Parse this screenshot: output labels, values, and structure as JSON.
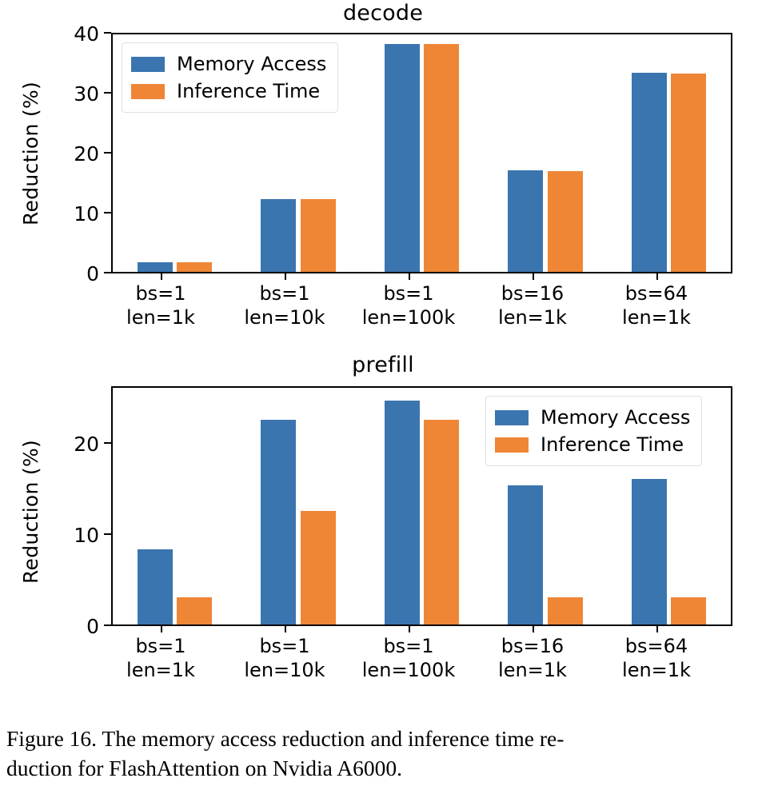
{
  "figure": {
    "caption_line1": "Figure 16.  The memory access reduction and inference time re-",
    "caption_line2": "duction for FlashAttention on Nvidia A6000."
  },
  "colors": {
    "memory_access": "#3b75af",
    "inference_time": "#ef8636",
    "axis": "#000000",
    "background": "#ffffff",
    "legend_border": "#e0e0e0"
  },
  "charts": [
    {
      "id": "decode",
      "title": "decode",
      "ylabel": "Reduction (%)",
      "yticks": [
        "0",
        "10",
        "20",
        "30",
        "40"
      ],
      "categories": [
        {
          "line1": "bs=1",
          "line2": "len=1k"
        },
        {
          "line1": "bs=1",
          "line2": "len=10k"
        },
        {
          "line1": "bs=1",
          "line2": "len=100k"
        },
        {
          "line1": "bs=16",
          "line2": "len=1k"
        },
        {
          "line1": "bs=64",
          "line2": "len=1k"
        }
      ],
      "legend": [
        {
          "label": "Memory Access",
          "color": "#3b75af"
        },
        {
          "label": "Inference Time",
          "color": "#ef8636"
        }
      ]
    },
    {
      "id": "prefill",
      "title": "prefill",
      "ylabel": "Reduction (%)",
      "yticks": [
        "0",
        "10",
        "20"
      ],
      "categories": [
        {
          "line1": "bs=1",
          "line2": "len=1k"
        },
        {
          "line1": "bs=1",
          "line2": "len=10k"
        },
        {
          "line1": "bs=1",
          "line2": "len=100k"
        },
        {
          "line1": "bs=16",
          "line2": "len=1k"
        },
        {
          "line1": "bs=64",
          "line2": "len=1k"
        }
      ],
      "legend": [
        {
          "label": "Memory Access",
          "color": "#3b75af"
        },
        {
          "label": "Inference Time",
          "color": "#ef8636"
        }
      ]
    }
  ],
  "chart_data": [
    {
      "type": "bar",
      "id": "decode",
      "title": "decode",
      "xlabel": "",
      "ylabel": "Reduction (%)",
      "ylim": [
        0,
        40
      ],
      "yticks": [
        0,
        10,
        20,
        30,
        40
      ],
      "grid": false,
      "legend_position": "upper left",
      "categories": [
        "bs=1\nlen=1k",
        "bs=1\nlen=10k",
        "bs=1\nlen=100k",
        "bs=16\nlen=1k",
        "bs=64\nlen=1k"
      ],
      "series": [
        {
          "name": "Memory Access",
          "color": "#3b75af",
          "values": [
            1.6,
            12.3,
            38.4,
            17.1,
            33.5
          ]
        },
        {
          "name": "Inference Time",
          "color": "#ef8636",
          "values": [
            1.6,
            12.3,
            38.4,
            17.0,
            33.4
          ]
        }
      ]
    },
    {
      "type": "bar",
      "id": "prefill",
      "title": "prefill",
      "xlabel": "",
      "ylabel": "Reduction (%)",
      "ylim": [
        0,
        26.2
      ],
      "yticks": [
        0,
        10,
        20
      ],
      "grid": false,
      "legend_position": "upper right",
      "categories": [
        "bs=1\nlen=1k",
        "bs=1\nlen=10k",
        "bs=1\nlen=100k",
        "bs=16\nlen=1k",
        "bs=64\nlen=1k"
      ],
      "series": [
        {
          "name": "Memory Access",
          "color": "#3b75af",
          "values": [
            8.3,
            22.7,
            24.8,
            15.4,
            16.1
          ]
        },
        {
          "name": "Inference Time",
          "color": "#ef8636",
          "values": [
            3.0,
            12.6,
            22.7,
            3.0,
            3.0
          ]
        }
      ]
    }
  ]
}
